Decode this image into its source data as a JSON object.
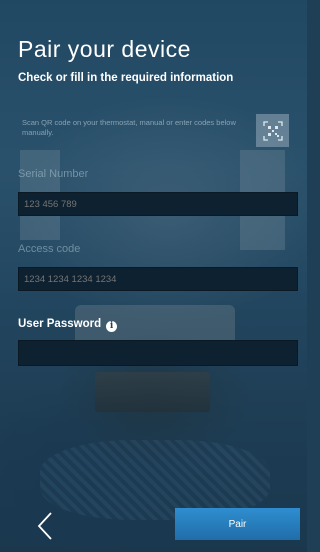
{
  "header": {
    "title": "Pair your device",
    "subtitle": "Check or fill in the required information"
  },
  "scan": {
    "hint": "Scan QR code on your thermostat, manual or enter codes below manually.",
    "icon": "qr-scan-icon"
  },
  "serial": {
    "label": "Serial Number",
    "placeholder": "123 456 789"
  },
  "access": {
    "label": "Access code",
    "placeholder": "1234 1234 1234 1234"
  },
  "password": {
    "label": "User Password",
    "info_icon": "info-icon",
    "value": ""
  },
  "footer": {
    "back_icon": "chevron-left-icon",
    "pair_label": "Pair"
  },
  "colors": {
    "accent": "#2b86c7",
    "field_bg": "#0d2130"
  }
}
